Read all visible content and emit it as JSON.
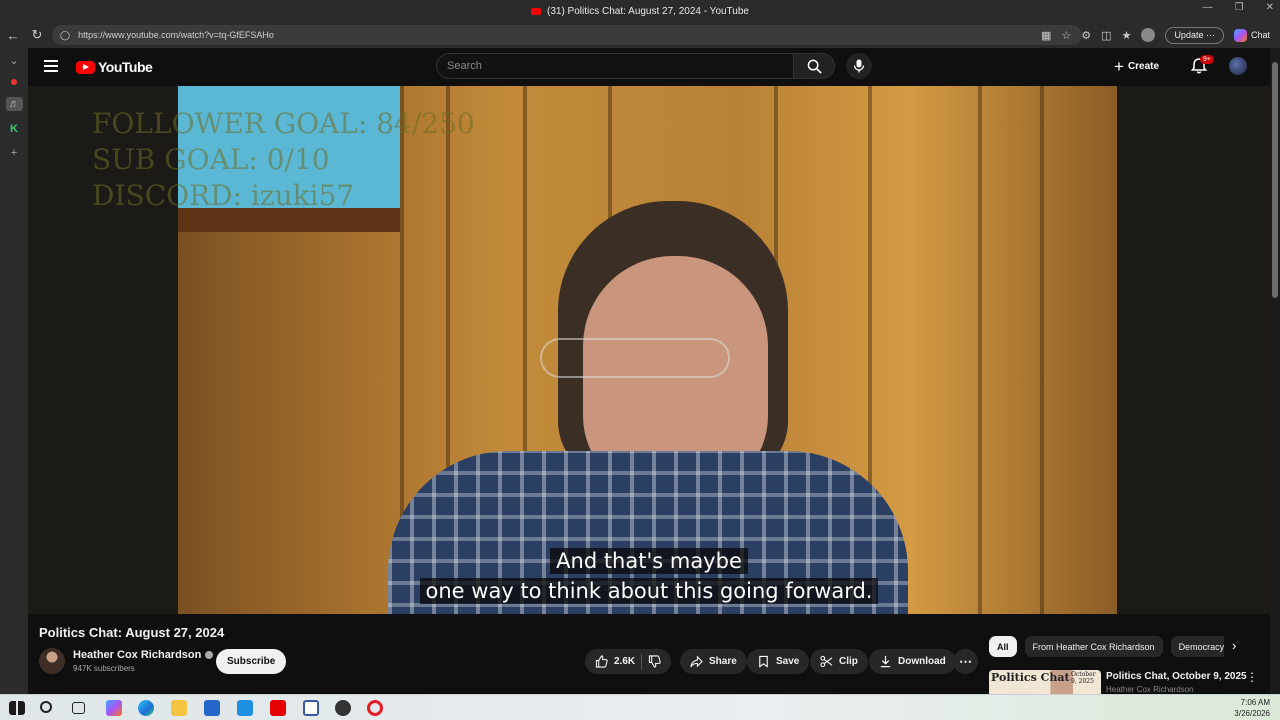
{
  "browser": {
    "tab_title": "(31) Politics Chat: August 27, 2024 - YouTube",
    "url": "https://www.youtube.com/watch?v=tq-GfEFSAHo",
    "update_label": "Update",
    "chat_label": "Chat"
  },
  "header": {
    "logo_text": "YouTube",
    "search_placeholder": "Search",
    "create_label": "Create",
    "notifications_badge": "9+"
  },
  "video": {
    "overlay_lines": [
      "FOLLOWER GOAL:  84/250",
      "SUB GOAL: 0/10",
      "DISCORD: izuki57"
    ],
    "caption_lines": [
      "And that's maybe",
      "one way to think about this going forward."
    ]
  },
  "meta": {
    "title": "Politics Chat: August 27, 2024",
    "channel_name": "Heather Cox Richardson",
    "subscribers": "947K subscribers",
    "subscribe_label": "Subscribe",
    "like_count": "2.6K",
    "share_label": "Share",
    "save_label": "Save",
    "clip_label": "Clip",
    "download_label": "Download"
  },
  "related": {
    "chips": [
      "All",
      "From Heather Cox Richardson",
      "Democracy"
    ],
    "items": [
      {
        "thumb_title": "Politics Chat",
        "thumb_date": "October 9, 2025",
        "title": "Politics Chat, October 9, 2025",
        "channel": "Heather Cox Richardson"
      }
    ]
  },
  "taskbar": {
    "time": "7:06 AM",
    "date": "3/26/2026"
  },
  "colors": {
    "youtube_red": "#ff0000",
    "background": "#0f0f0f",
    "chip_bg": "#272727",
    "subscribe_bg": "#f1f1f1"
  }
}
